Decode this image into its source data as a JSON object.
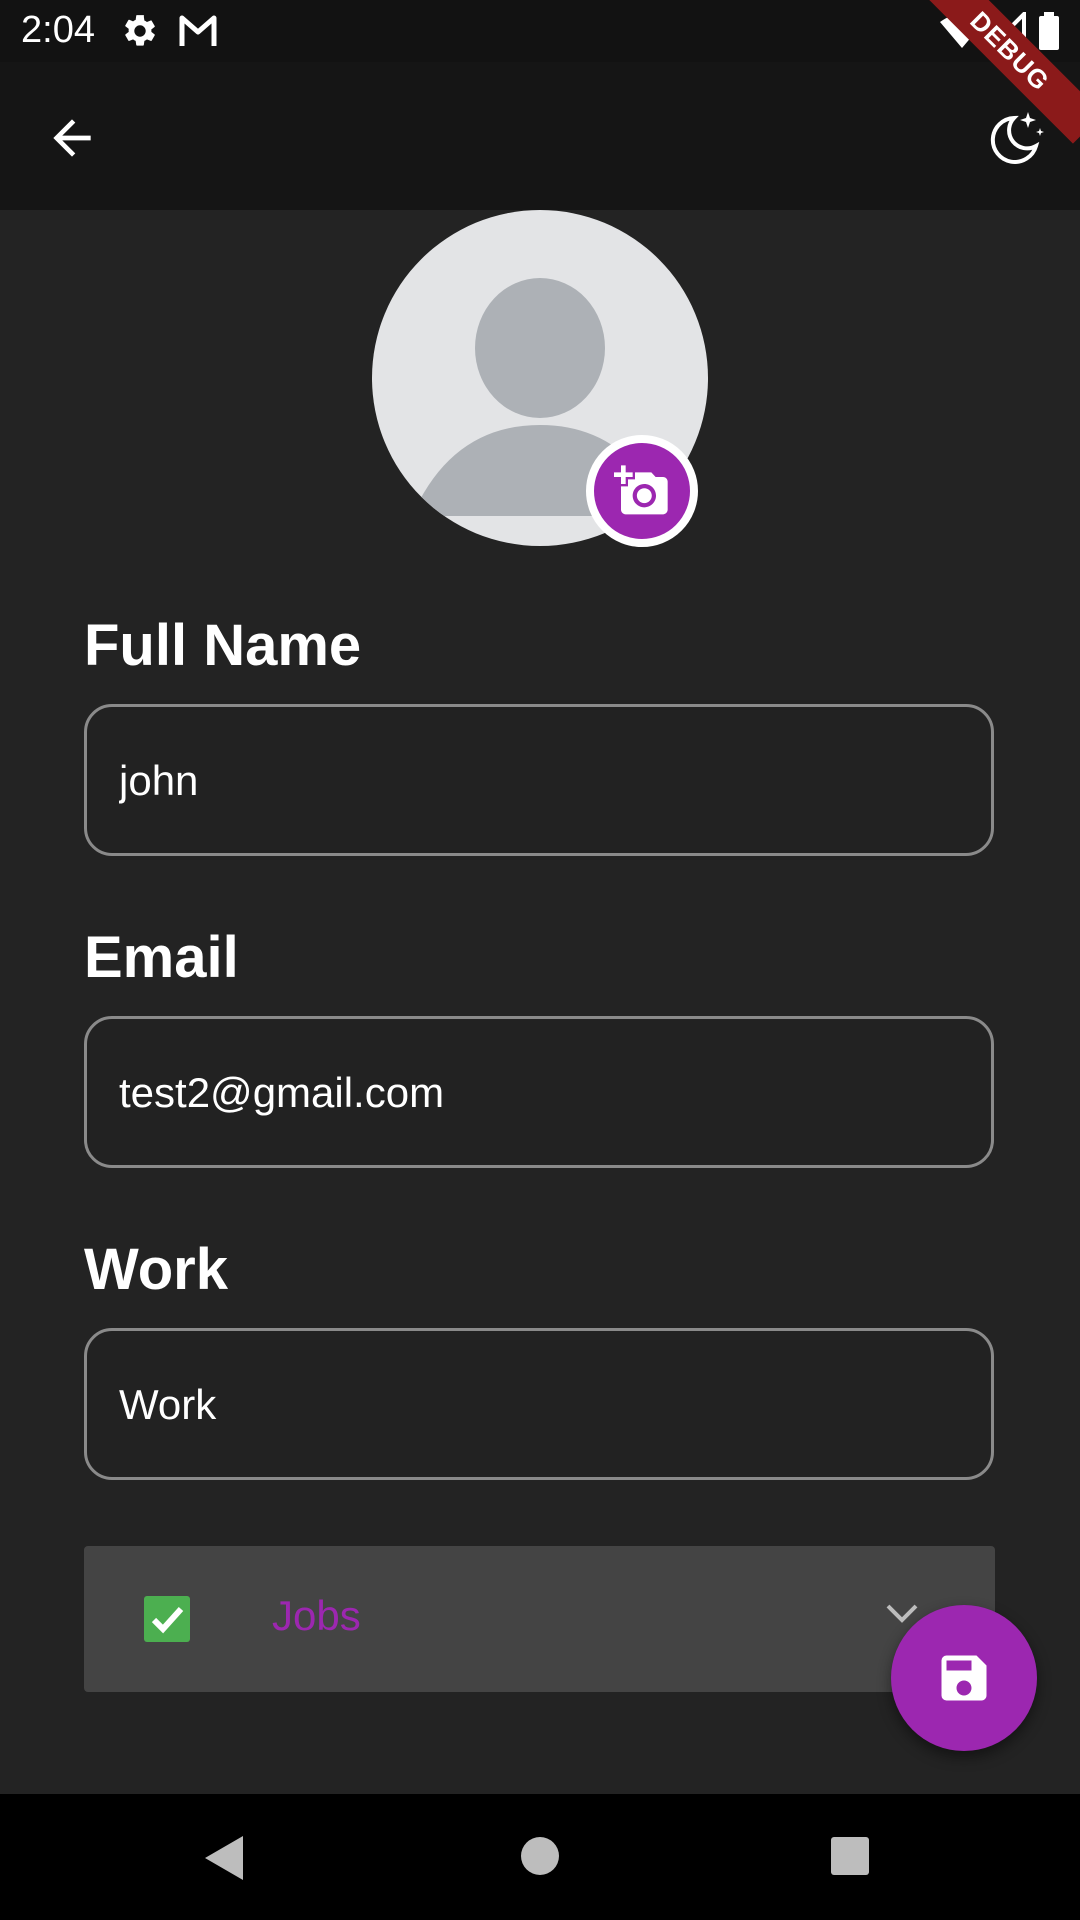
{
  "status_bar": {
    "time": "2:04",
    "icons": [
      "settings-icon",
      "gmail-icon",
      "wifi-icon",
      "signal-icon",
      "battery-icon"
    ]
  },
  "debug_banner": {
    "label": "DEBUG"
  },
  "app_bar": {
    "back_icon": "arrow-back-icon",
    "theme_icon": "dark-mode-icon"
  },
  "avatar": {
    "placeholder_icon": "person-icon",
    "camera_icon": "add-photo-icon"
  },
  "form": {
    "full_name": {
      "label": "Full Name",
      "value": "john"
    },
    "email": {
      "label": "Email",
      "value": "test2@gmail.com"
    },
    "work": {
      "label": "Work",
      "value": "Work"
    }
  },
  "jobs": {
    "label": "Jobs",
    "checked": true
  },
  "fab": {
    "icon": "save-icon"
  },
  "colors": {
    "accent": "#9c27b0",
    "check": "#4caf50",
    "background": "#232323"
  },
  "nav_bar": {
    "icons": [
      "back-triangle-icon",
      "home-circle-icon",
      "recents-square-icon"
    ]
  }
}
